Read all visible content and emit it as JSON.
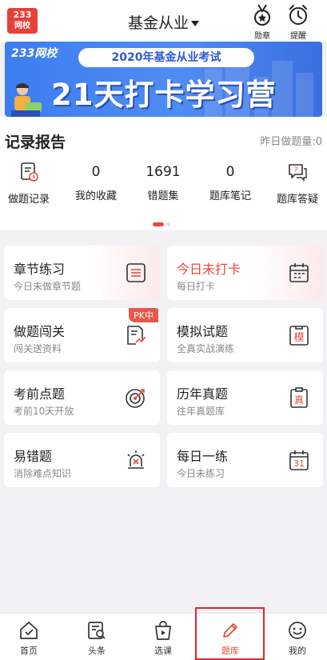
{
  "header": {
    "logo_line1": "233",
    "logo_line2": "网校",
    "title": "基金从业",
    "medal_label": "勋章",
    "remind_label": "提醒"
  },
  "banner": {
    "brand": "233网校",
    "subtitle": "2020年基金从业考试",
    "headline": "21天打卡学习营"
  },
  "record": {
    "title": "记录报告",
    "yesterday": "昨日做题量:0",
    "items": [
      {
        "label": "做题记录",
        "icon": "clipboard-clock-icon"
      },
      {
        "label": "我的收藏",
        "value": "0"
      },
      {
        "label": "错题集",
        "value": "1691"
      },
      {
        "label": "题库笔记",
        "value": "0"
      },
      {
        "label": "题库答疑",
        "icon": "chat-question-icon"
      }
    ]
  },
  "cards": [
    {
      "title": "章节练习",
      "sub": "今日未做章节题",
      "icon": "list-doc-icon"
    },
    {
      "title": "今日未打卡",
      "sub": "每日打卡",
      "icon": "calendar-icon"
    },
    {
      "title": "做题闯关",
      "sub": "闯关送资料",
      "icon": "doc-trend-icon",
      "badge": "PK中"
    },
    {
      "title": "模拟试题",
      "sub": "全真实战演练",
      "icon": "mock-exam-icon",
      "icon_text": "模"
    },
    {
      "title": "考前点题",
      "sub": "考前10天开放",
      "icon": "target-icon"
    },
    {
      "title": "历年真题",
      "sub": "往年真题库",
      "icon": "real-exam-icon",
      "icon_text": "真"
    },
    {
      "title": "易错题",
      "sub": "消除难点知识",
      "icon": "alarm-icon"
    },
    {
      "title": "每日一练",
      "sub": "今日未练习",
      "icon": "calendar-31-icon",
      "icon_text": "31"
    }
  ],
  "tabs": [
    {
      "label": "首页",
      "icon": "home-check-icon"
    },
    {
      "label": "头条",
      "icon": "news-search-icon"
    },
    {
      "label": "选课",
      "icon": "shopping-bag-play-icon"
    },
    {
      "label": "题库",
      "icon": "pencil-icon"
    },
    {
      "label": "我的",
      "icon": "smile-icon"
    }
  ],
  "colors": {
    "accent": "#e64a3b",
    "banner_blue": "#3c7df0",
    "highlight_box": "#e0262c"
  }
}
